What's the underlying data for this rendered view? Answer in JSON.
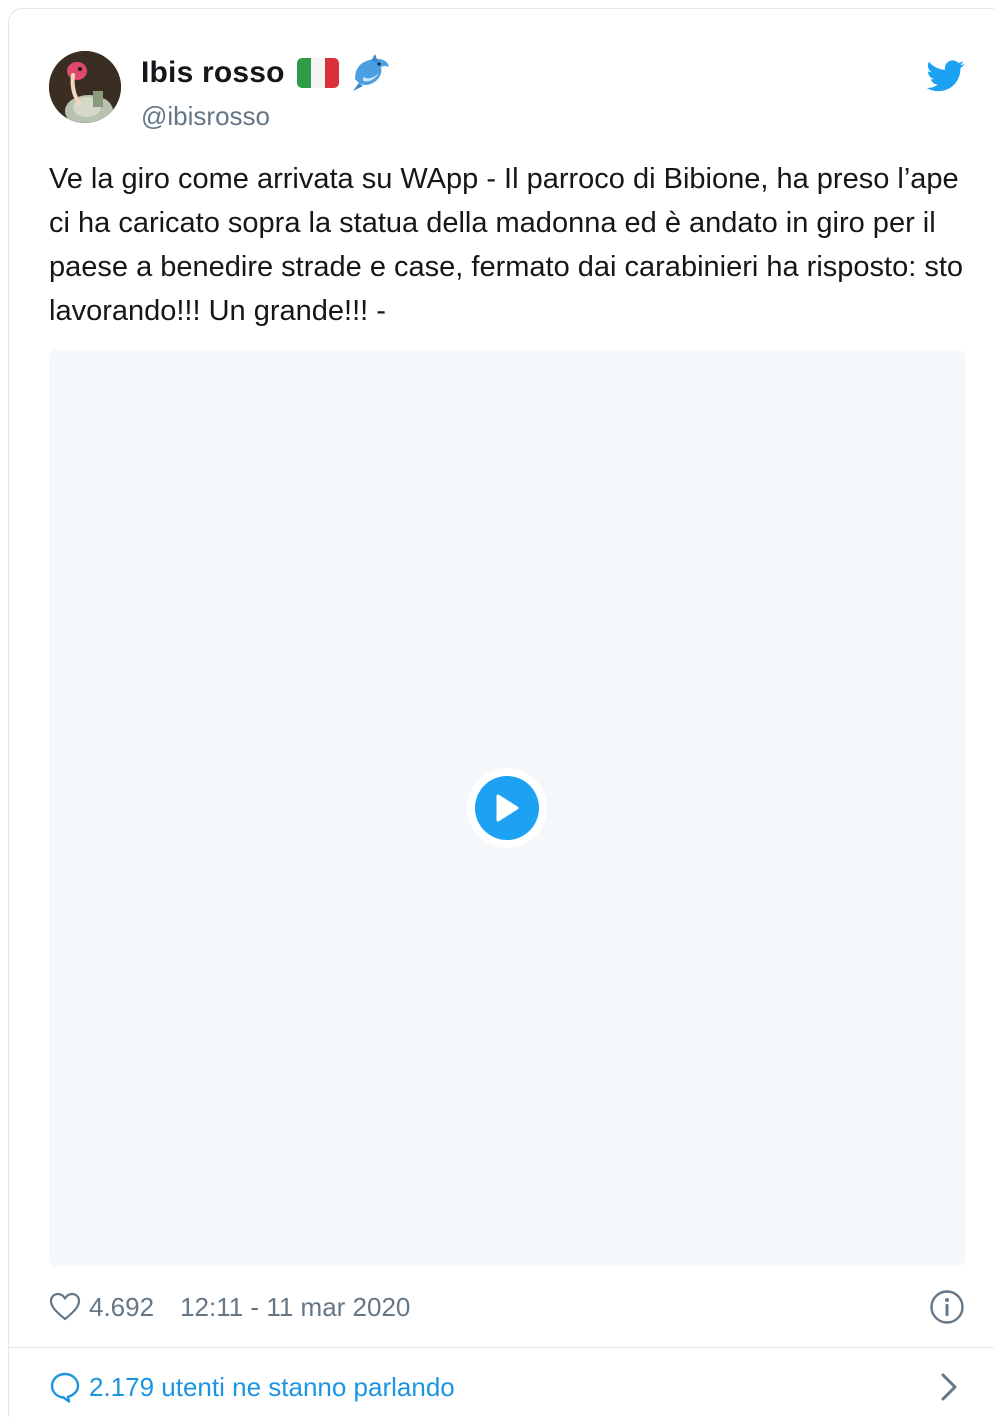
{
  "author": {
    "display_name": "Ibis rosso",
    "handle": "@ibisrosso",
    "badges": [
      "italy-flag-icon",
      "dolphin-icon"
    ]
  },
  "tweet": {
    "text": "Ve la giro come arrivata su WApp - Il parroco di Bibione, ha preso l’ape ci ha caricato sopra la statua della madonna ed è andato in giro per il paese a benedire strade e case, fermato dai carabinieri ha risposto: sto lavorando!!! Un grande!!! -"
  },
  "media": {
    "type": "video",
    "control_icon": "play-icon"
  },
  "meta": {
    "likes": "4.692",
    "timestamp": "12:11 - 11 mar 2020"
  },
  "footer": {
    "conversation_label": "2.179 utenti ne stanno parlando"
  },
  "colors": {
    "accent": "#1da1f2",
    "link": "#1b95e0",
    "text": "#14171a",
    "muted": "#657786",
    "media_bg": "#f5f8fa",
    "border": "#e1e8ed"
  }
}
